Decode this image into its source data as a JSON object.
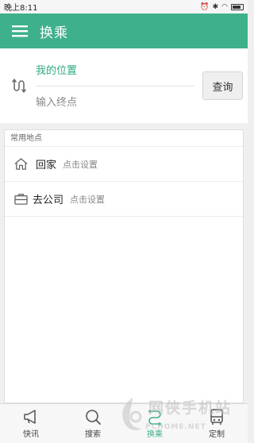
{
  "status_bar": {
    "time": "晚上8:11",
    "icons": [
      "alarm-icon",
      "bluetooth-icon",
      "wifi-icon",
      "battery-icon"
    ]
  },
  "app_bar": {
    "title": "换乘",
    "menu_icon": "hamburger-menu-icon",
    "color": "#3fb08c"
  },
  "route": {
    "from_value": "我的位置",
    "to_placeholder": "输入终点",
    "query_label": "查询",
    "swap_icon": "swap-route-icon"
  },
  "places": {
    "header": "常用地点",
    "items": [
      {
        "name": "回家",
        "hint": "点击设置",
        "icon": "home-icon"
      },
      {
        "name": "去公司",
        "hint": "点击设置",
        "icon": "briefcase-icon"
      }
    ]
  },
  "bottom_nav": {
    "items": [
      {
        "label": "快讯",
        "icon": "megaphone-icon"
      },
      {
        "label": "搜索",
        "icon": "search-icon"
      },
      {
        "label": "换乘",
        "icon": "transfer-icon",
        "active": true
      },
      {
        "label": "定制",
        "icon": "bus-icon"
      }
    ]
  },
  "watermark": {
    "title": "网侠手机站",
    "subtitle": "PCHOME.NET"
  }
}
